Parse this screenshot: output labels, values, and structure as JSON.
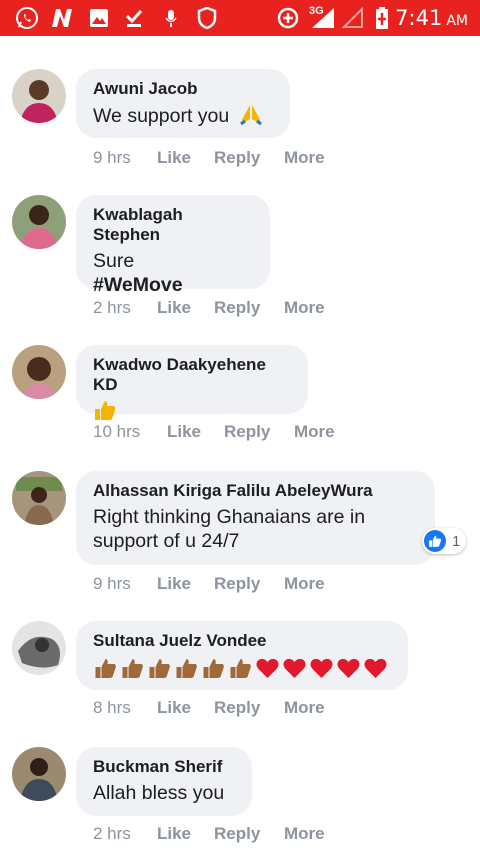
{
  "status_bar": {
    "network": "3G",
    "time": "7:41",
    "ampm": "AM",
    "color": "#e8231f",
    "left_icons": [
      "whatsapp-icon",
      "n-app-icon",
      "gallery-icon",
      "download-done-icon",
      "microphone-icon",
      "shield-icon"
    ],
    "right_icons": [
      "data-saver-icon",
      "signal-icon",
      "signal-empty-icon",
      "battery-charging-icon"
    ]
  },
  "actions": {
    "like": "Like",
    "reply": "Reply",
    "more": "More"
  },
  "comments": [
    {
      "author": "Awuni Jacob",
      "text": "We support you",
      "emoji": "folded-hands",
      "time": "9 hrs"
    },
    {
      "author": "Kwablagah Stephen",
      "text": "Sure",
      "hashtag": "#WeMove",
      "time": "2 hrs"
    },
    {
      "author": "Kwadwo Daakyehene KD",
      "emoji": "thumbs-up",
      "time": "10 hrs"
    },
    {
      "author": "Alhassan Kiriga Falilu AbeleyWura",
      "text_line1": "Right thinking Ghanaians are in",
      "text_line2": "support of u 24/7",
      "time": "9 hrs",
      "reactions": "1"
    },
    {
      "author": "Sultana Juelz Vondee",
      "emoji": "6 thumbs-up, 5 red hearts",
      "time": "8 hrs"
    },
    {
      "author": "Buckman Sherif",
      "text": "Allah bless you",
      "time": "2 hrs"
    }
  ]
}
